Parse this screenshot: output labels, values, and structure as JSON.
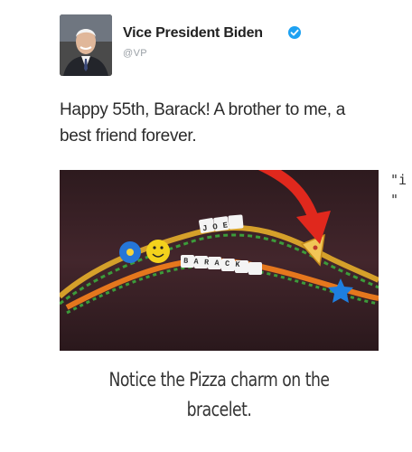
{
  "tweet": {
    "author_name": "Vice President Biden",
    "handle": "@VP",
    "verified": true,
    "text": "Happy 55th, Barack! A brother to me, a best friend forever."
  },
  "photo": {
    "bead_words": [
      "JOE",
      "BARACK"
    ],
    "annotation": "red-arrow pointing to pizza charm"
  },
  "right_fragment": {
    "line1": "\"i",
    "line2": "\""
  },
  "caption": "Notice the Pizza charm on the bracelet.",
  "colors": {
    "arrow": "#e0281d",
    "verified_badge": "#1da1f2",
    "photo_background": "#3a2126"
  }
}
